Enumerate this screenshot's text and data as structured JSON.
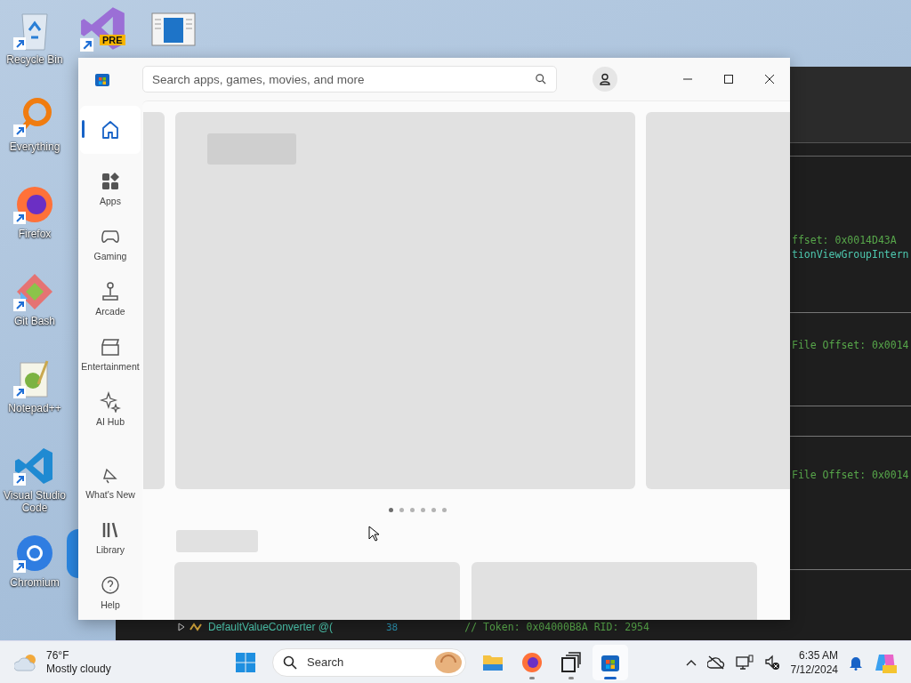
{
  "desktop_icons": [
    {
      "kind": "recycle",
      "label": "Recycle Bin"
    },
    {
      "kind": "everything",
      "label": "Everything"
    },
    {
      "kind": "firefox",
      "label": "Firefox"
    },
    {
      "kind": "git",
      "label": "Git Bash"
    },
    {
      "kind": "notepad",
      "label": "Notepad++"
    },
    {
      "kind": "vscode",
      "label": "Visual Studio Code"
    },
    {
      "kind": "chromium",
      "label": "Chromium"
    }
  ],
  "top_icons": [
    {
      "kind": "vspreview",
      "badge": "PRE"
    },
    {
      "kind": "document"
    }
  ],
  "code_window": {
    "blocks": [
      {
        "lines": [
          {
            "kind": "comment",
            "text": "ffset: 0x0014D43A"
          },
          {
            "kind": "type",
            "text": "tionViewGroupIntern"
          }
        ]
      },
      {
        "lines": [
          {
            "kind": "comment",
            "text": "File Offset: 0x0014"
          }
        ]
      },
      {
        "lines": [
          {
            "kind": "comment",
            "text": "File Offset: 0x0014"
          }
        ]
      }
    ],
    "tree_item": "DefaultValueConverter @(",
    "line_number": "38",
    "code_line": "// Token: 0x04000B8A RID: 2954"
  },
  "store_window": {
    "search": {
      "placeholder": "Search apps, games, movies, and more"
    },
    "nav": [
      {
        "kind": "home",
        "selected": true
      },
      {
        "kind": "apps",
        "label": "Apps",
        "selected": false
      },
      {
        "kind": "gaming",
        "label": "Gaming",
        "selected": false
      },
      {
        "kind": "arcade",
        "label": "Arcade",
        "selected": false
      },
      {
        "kind": "entertainment",
        "label": "Entertainment",
        "selected": false
      },
      {
        "kind": "ai",
        "label": "AI Hub",
        "selected": false
      }
    ],
    "nav_bottom": [
      {
        "kind": "new",
        "label": "What's New",
        "selected": false
      },
      {
        "kind": "library",
        "label": "Library",
        "selected": false
      },
      {
        "kind": "help",
        "label": "Help",
        "selected": false
      }
    ],
    "carousel_dots": [
      {
        "selected": true
      },
      {
        "selected": false
      },
      {
        "selected": false
      },
      {
        "selected": false
      },
      {
        "selected": false
      },
      {
        "selected": false
      }
    ]
  },
  "taskbar": {
    "weather": {
      "temperature": "76°F",
      "condition": "Mostly cloudy"
    },
    "search": {
      "placeholder": "Search"
    },
    "apps": [
      {
        "kind": "files",
        "running": false,
        "active": false
      },
      {
        "kind": "firefox",
        "running": true,
        "active": false
      },
      {
        "kind": "taskview",
        "running": true,
        "active": false
      },
      {
        "kind": "store",
        "running": true,
        "active": true
      }
    ],
    "tray": [
      {
        "kind": "chevron"
      },
      {
        "kind": "cloud"
      },
      {
        "kind": "network"
      },
      {
        "kind": "volume"
      }
    ],
    "time": "6:35 AM",
    "date": "7/12/2024"
  }
}
